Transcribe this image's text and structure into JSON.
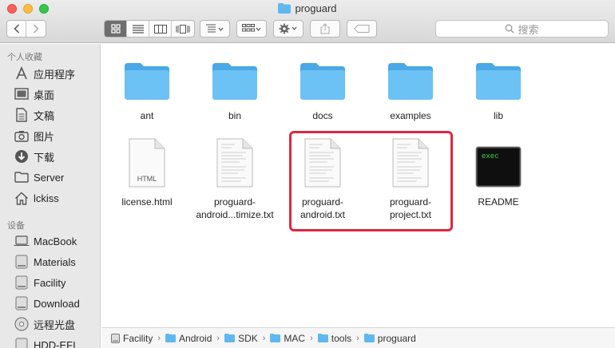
{
  "window": {
    "title": "proguard"
  },
  "toolbar": {
    "back_icon": "chevron-left-icon",
    "forward_icon": "chevron-right-icon",
    "view_modes": [
      "icon-view",
      "list-view",
      "column-view",
      "cover-flow-view"
    ],
    "search_placeholder": "搜索"
  },
  "sidebar": {
    "favorites_header": "个人收藏",
    "favorites": [
      {
        "label": "应用程序",
        "icon": "applications-icon"
      },
      {
        "label": "桌面",
        "icon": "desktop-icon"
      },
      {
        "label": "文稿",
        "icon": "documents-icon"
      },
      {
        "label": "图片",
        "icon": "pictures-icon"
      },
      {
        "label": "下载",
        "icon": "downloads-icon"
      },
      {
        "label": "Server",
        "icon": "folder-icon"
      },
      {
        "label": "lckiss",
        "icon": "home-icon"
      }
    ],
    "devices_header": "设备",
    "devices": [
      {
        "label": "MacBook",
        "icon": "laptop-icon"
      },
      {
        "label": "Materials",
        "icon": "disk-icon"
      },
      {
        "label": "Facility",
        "icon": "disk-icon"
      },
      {
        "label": "Download",
        "icon": "disk-icon"
      },
      {
        "label": "远程光盘",
        "icon": "optical-disc-icon"
      },
      {
        "label": "HDD-EFI",
        "icon": "disk-icon"
      }
    ]
  },
  "files": [
    {
      "name": "ant",
      "kind": "folder"
    },
    {
      "name": "bin",
      "kind": "folder"
    },
    {
      "name": "docs",
      "kind": "folder"
    },
    {
      "name": "examples",
      "kind": "folder"
    },
    {
      "name": "lib",
      "kind": "folder"
    },
    {
      "name": "license.html",
      "kind": "html",
      "badge": "HTML"
    },
    {
      "name": "proguard-android...timize.txt",
      "line1": "proguard-",
      "line2": "android...timize.txt",
      "kind": "text"
    },
    {
      "name": "proguard-android.txt",
      "line1": "proguard-",
      "line2": "android.txt",
      "kind": "text"
    },
    {
      "name": "proguard-project.txt",
      "line1": "proguard-",
      "line2": "project.txt",
      "kind": "text"
    },
    {
      "name": "README",
      "kind": "exec",
      "badge": "exec"
    }
  ],
  "pathbar": [
    "Facility",
    "Android",
    "SDK",
    "MAC",
    "tools",
    "proguard"
  ],
  "colors": {
    "folder": "#5fb8f0",
    "highlight": "#e0263f",
    "selected_segment": "#6e6e6e"
  }
}
